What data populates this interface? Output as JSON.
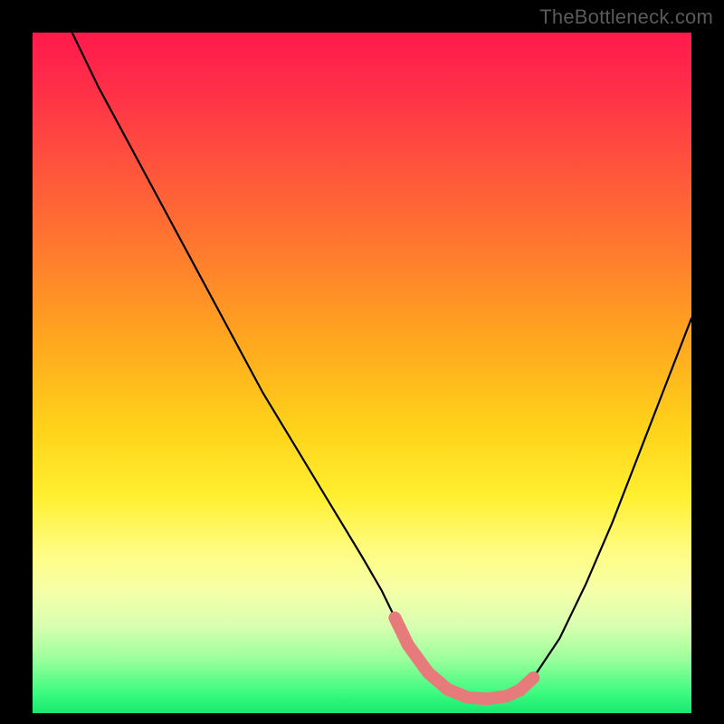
{
  "watermark": "TheBottleneck.com",
  "chart_data": {
    "type": "line",
    "title": "",
    "xlabel": "",
    "ylabel": "",
    "xlim": [
      0,
      100
    ],
    "ylim": [
      0,
      100
    ],
    "series": [
      {
        "name": "curve",
        "x": [
          6,
          10,
          15,
          20,
          25,
          30,
          35,
          40,
          45,
          50,
          53,
          55,
          57,
          60,
          63,
          66,
          69,
          72,
          74,
          76,
          80,
          84,
          88,
          92,
          96,
          100
        ],
        "values": [
          100,
          92,
          83,
          74,
          65,
          56,
          47,
          39,
          31,
          23,
          18,
          14,
          10,
          6,
          3.5,
          2.3,
          2.1,
          2.5,
          3.4,
          5.2,
          11,
          19,
          28,
          38,
          48,
          58
        ]
      }
    ],
    "highlight_segment": {
      "comment": "pink thick overlay near bottom of valley",
      "x": [
        55,
        57,
        60,
        63,
        66,
        69,
        72,
        74,
        76
      ],
      "values": [
        14,
        10,
        6,
        3.5,
        2.3,
        2.1,
        2.5,
        3.4,
        5.2
      ]
    },
    "colors": {
      "curve": "#000000",
      "highlight": "#e77b7b",
      "gradient_top": "#ff1a4d",
      "gradient_bottom": "#18e870"
    }
  }
}
